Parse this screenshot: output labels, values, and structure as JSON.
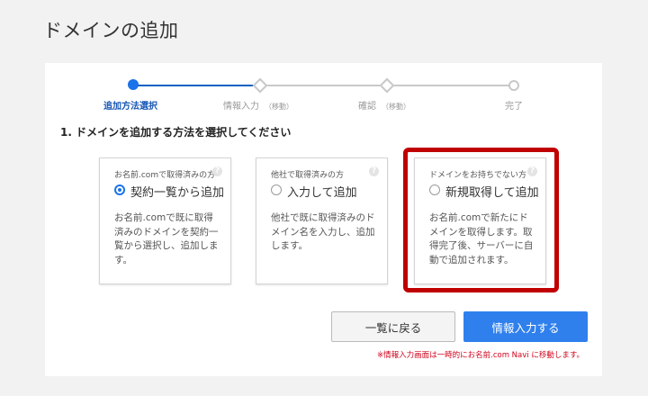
{
  "page_title": "ドメインの追加",
  "stepper": {
    "steps": [
      {
        "label": "追加方法選択",
        "sub": ""
      },
      {
        "label": "情報入力",
        "sub": "（移動）"
      },
      {
        "label": "確認",
        "sub": "（移動）"
      },
      {
        "label": "完了",
        "sub": ""
      }
    ]
  },
  "section_heading": "1. ドメインを追加する方法を選択してください",
  "cards": [
    {
      "caption": "お名前.comで取得済みの方",
      "option": "契約一覧から追加",
      "description": "お名前.comで既に取得済みのドメインを契約一覧から選択し、追加します。",
      "selected": true
    },
    {
      "caption": "他社で取得済みの方",
      "option": "入力して追加",
      "description": "他社で既に取得済みのドメイン名を入力し、追加します。",
      "selected": false
    },
    {
      "caption": "ドメインをお持ちでない方",
      "option": "新規取得して追加",
      "description": "お名前.comで新たにドメインを取得します。取得完了後、サーバーに自動で追加されます。",
      "selected": false
    }
  ],
  "help_icon_glyph": "?",
  "buttons": {
    "back": "一覧に戻る",
    "next": "情報入力する"
  },
  "note": "※情報入力画面は一時的にお名前.com Navi に移動します。",
  "colors": {
    "accent": "#2f80ed",
    "highlight": "#c00000",
    "note": "#d0021b"
  }
}
